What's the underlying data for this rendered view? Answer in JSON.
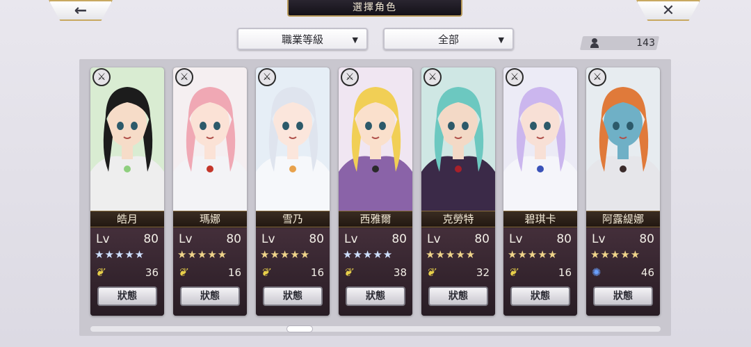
{
  "header": {
    "title": "選擇角色",
    "back_icon": "←",
    "close_icon": "✕"
  },
  "filters": {
    "class_select": "職業等級",
    "scope_select": "全部",
    "arrow": "▼"
  },
  "roster_count": "143",
  "characters": [
    {
      "name": "皓月",
      "lv_label": "Lv",
      "level": "80",
      "stars": "★★★★★",
      "star_color": "blue",
      "element": "wind",
      "element_icon": "❦",
      "count": "36",
      "status_label": "狀態",
      "palette": {
        "bg": "#d9ecd2",
        "hair": "#1c1c1c",
        "skin": "#f6dcc8",
        "cloth": "#eeeeee",
        "accent": "#8fcf7e"
      }
    },
    {
      "name": "瑪娜",
      "lv_label": "Lv",
      "level": "80",
      "stars": "★★★★★",
      "star_color": "gold",
      "element": "wind",
      "element_icon": "❦",
      "count": "16",
      "status_label": "狀態",
      "palette": {
        "bg": "#f5eff1",
        "hair": "#f0a8b4",
        "skin": "#fbe2d6",
        "cloth": "#f3f3f6",
        "accent": "#c4362a"
      }
    },
    {
      "name": "雪乃",
      "lv_label": "Lv",
      "level": "80",
      "stars": "★★★★★",
      "star_color": "gold",
      "element": "wind",
      "element_icon": "❦",
      "count": "16",
      "status_label": "狀態",
      "palette": {
        "bg": "#e6eef6",
        "hair": "#dfe4ee",
        "skin": "#fbe6dc",
        "cloth": "#f6f8fb",
        "accent": "#e8a24c"
      }
    },
    {
      "name": "西雅爾",
      "lv_label": "Lv",
      "level": "80",
      "stars": "★★★★★",
      "star_color": "blue",
      "element": "wind",
      "element_icon": "❦",
      "count": "38",
      "status_label": "狀態",
      "palette": {
        "bg": "#f0e6f2",
        "hair": "#f1cf55",
        "skin": "#fae0cc",
        "cloth": "#8a63a8",
        "accent": "#2a2a2a"
      }
    },
    {
      "name": "克勞特",
      "lv_label": "Lv",
      "level": "80",
      "stars": "★★★★★",
      "star_color": "gold",
      "element": "wind",
      "element_icon": "❦",
      "count": "32",
      "status_label": "狀態",
      "palette": {
        "bg": "#cfe7e4",
        "hair": "#6cc8c0",
        "skin": "#f3d9c6",
        "cloth": "#3b2a48",
        "accent": "#a8202a"
      }
    },
    {
      "name": "碧琪卡",
      "lv_label": "Lv",
      "level": "80",
      "stars": "★★★★★",
      "star_color": "gold",
      "element": "wind",
      "element_icon": "❦",
      "count": "16",
      "status_label": "狀態",
      "palette": {
        "bg": "#ecebf6",
        "hair": "#cbb6ee",
        "skin": "#f8e0d6",
        "cloth": "#f5f5fa",
        "accent": "#3a52b8"
      }
    },
    {
      "name": "阿露緹娜",
      "lv_label": "Lv",
      "level": "80",
      "stars": "★★★★★",
      "star_color": "gold",
      "element": "water",
      "element_icon": "✺",
      "count": "46",
      "status_label": "狀態",
      "palette": {
        "bg": "#e7ecf0",
        "hair": "#e07a3a",
        "skin": "#6fb0c6",
        "cloth": "#e6e6ea",
        "accent": "#3a2a2a"
      }
    }
  ],
  "class_badge_icon": "⚔"
}
